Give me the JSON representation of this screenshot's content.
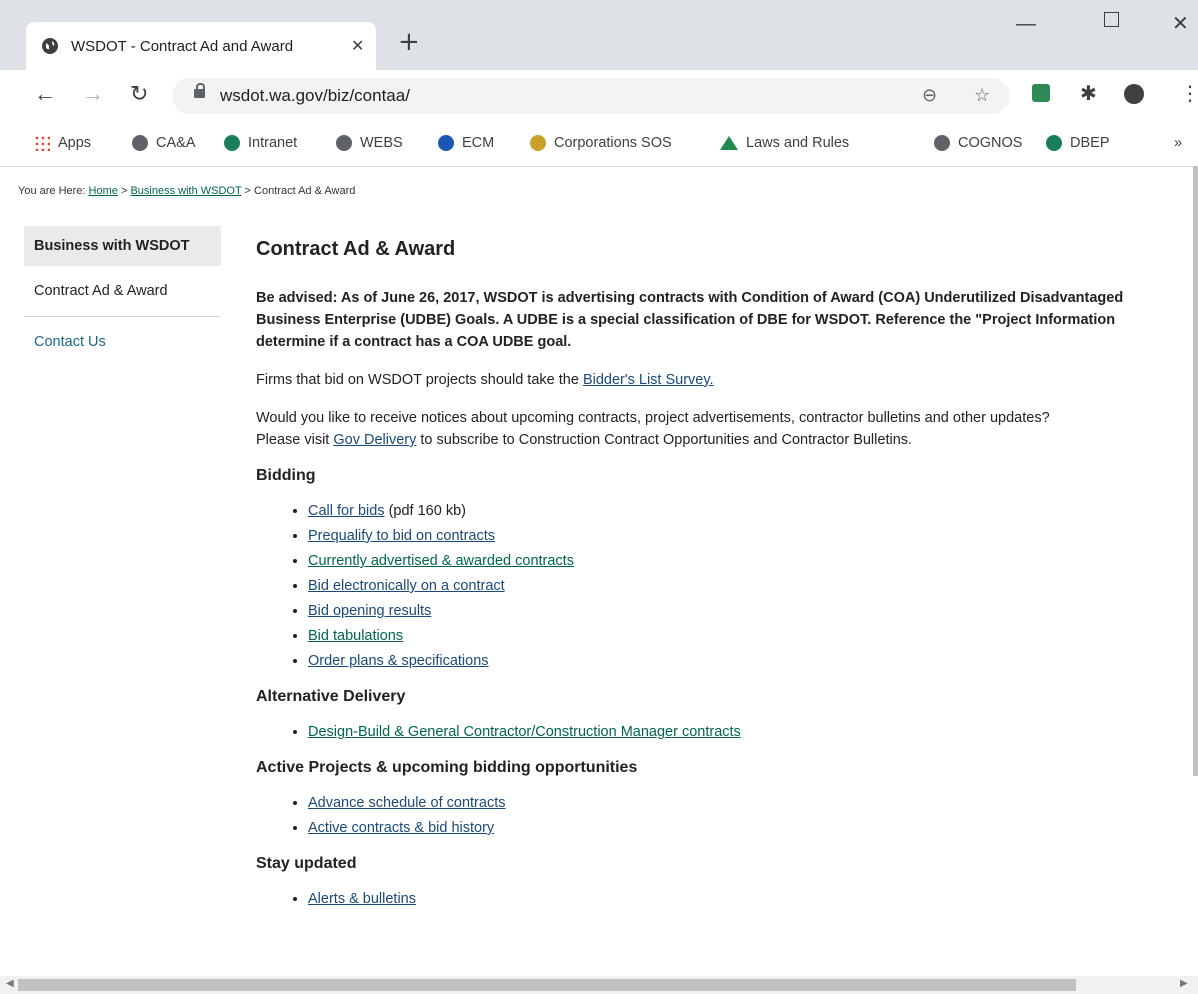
{
  "browser": {
    "tab_title": "WSDOT - Contract Ad and Award",
    "tab_close": "✕",
    "new_tab": "+",
    "url": "wsdot.wa.gov/biz/contaa/",
    "bookmarks": [
      "Apps",
      "CA&A",
      "Intranet",
      "WEBS",
      "ECM",
      "Corporations SOS",
      "Laws and Rules",
      "COGNOS",
      "DBEP"
    ],
    "bookmarks_more": "»"
  },
  "breadcrumb": {
    "prefix": "You are Here:",
    "home": "Home",
    "sep1": " > ",
    "business": "Business with WSDOT",
    "sep2": " > ",
    "current": "Contract Ad & Award"
  },
  "sidenav": {
    "heading": "Business with WSDOT",
    "current": "Contract Ad & Award",
    "contact": "Contact Us"
  },
  "main": {
    "title": "Contract Ad & Award",
    "advisory": [
      "Be advised: As of June 26, 2017, WSDOT is advertising contracts with Condition of Award (COA) Underutilized Disadvantaged",
      "Business Enterprise (UDBE) Goals. A UDBE is a special classification of DBE for WSDOT. Reference the \"Project Information",
      "determine if a contract has a COA UDBE goal."
    ],
    "survey_text": "Firms that bid on WSDOT projects should take the ",
    "survey_link": "Bidder's List Survey.",
    "notices_line1": "Would you like to receive notices about upcoming contracts, project advertisements, contractor bulletins and other updates?",
    "notices_line2_pre": "Please visit ",
    "notices_link": "Gov Delivery",
    "notices_line2_post": " to subscribe to Construction Contract Opportunities and Contractor Bulletins.",
    "bidding": {
      "heading": "Bidding",
      "items": [
        "Call for bids",
        "Prequalify to bid on contracts",
        "Currently advertised & awarded contracts",
        "Bid electronically on a contract",
        "Bid opening results",
        "Bid tabulations",
        "Order plans & specifications"
      ],
      "call_for_bids_note": " (pdf 160 kb)"
    },
    "alt_delivery": {
      "heading": "Alternative Delivery",
      "items": [
        "Design-Build & General Contractor/Construction Manager contracts"
      ]
    },
    "active_projects": {
      "heading": "Active Projects & upcoming bidding opportunities",
      "items": [
        "Advance schedule of contracts",
        "Active contracts & bid history"
      ]
    },
    "stay_updated": {
      "heading": "Stay updated",
      "items": [
        "Alerts & bulletins"
      ]
    }
  }
}
